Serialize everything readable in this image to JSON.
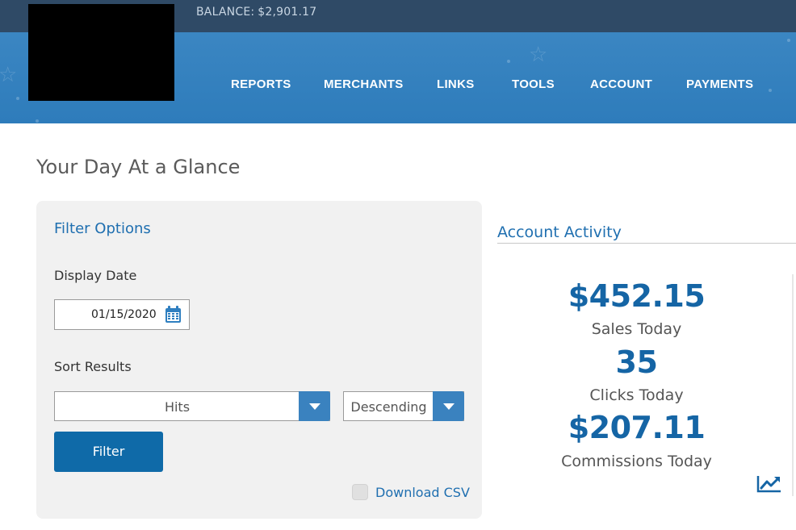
{
  "header": {
    "balance_label": "BALANCE:",
    "balance_value": "$2,901.17"
  },
  "nav": {
    "items": [
      {
        "label": "REPORTS"
      },
      {
        "label": "MERCHANTS"
      },
      {
        "label": "LINKS"
      },
      {
        "label": "TOOLS"
      },
      {
        "label": "ACCOUNT"
      },
      {
        "label": "PAYMENTS"
      }
    ]
  },
  "page": {
    "title": "Your Day At a Glance"
  },
  "filter": {
    "title": "Filter Options",
    "display_date_label": "Display Date",
    "display_date_value": "01/15/2020",
    "sort_label": "Sort Results",
    "sort_field_value": "Hits",
    "sort_order_value": "Descending",
    "filter_button": "Filter",
    "download_csv_label": "Download CSV",
    "download_csv_checked": false
  },
  "activity": {
    "title": "Account Activity",
    "sales_value": "$452.15",
    "sales_label": "Sales Today",
    "clicks_value": "35",
    "clicks_label": "Clicks Today",
    "commissions_value": "$207.11",
    "commissions_label": "Commissions Today"
  },
  "icons": {
    "calendar": "calendar-icon",
    "dropdown": "chevron-down-icon",
    "trend": "trend-up-icon"
  },
  "colors": {
    "topbar": "#2f4a66",
    "nav_band": "#3282c0",
    "accent": "#1565a5",
    "button": "#0f6aa8"
  }
}
